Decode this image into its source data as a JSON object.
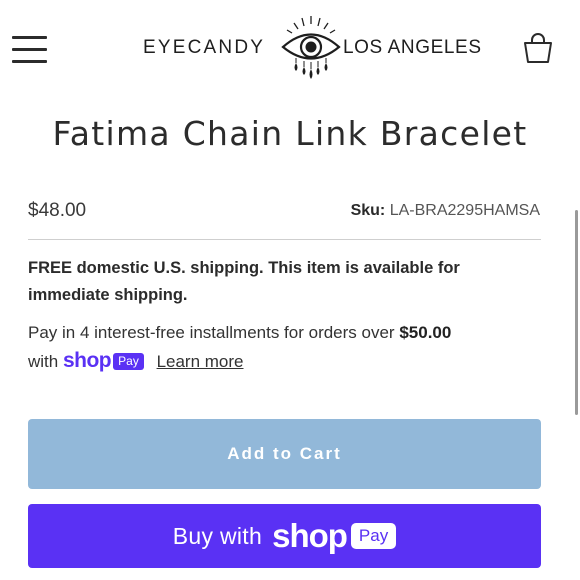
{
  "header": {
    "logo_left": "EYECANDY",
    "logo_right": "LOS ANGELES",
    "menu_icon": "hamburger-menu-icon",
    "cart_icon": "shopping-bag-icon"
  },
  "product": {
    "title": "Fatima Chain Link Bracelet",
    "price": "$48.00",
    "sku_label": "Sku:",
    "sku_value": "LA-BRA2295HAMSA"
  },
  "shipping_note": "FREE domestic U.S. shipping. This item is available for immediate shipping.",
  "installments": {
    "prefix": "Pay in 4 interest-free installments for orders over",
    "amount": "$50.00",
    "with": "with",
    "shop": "shop",
    "pay": "Pay",
    "learn_more": "Learn more"
  },
  "buttons": {
    "add_to_cart": "Add to Cart",
    "buy_with": "Buy with",
    "shop": "shop",
    "pay": "Pay"
  },
  "colors": {
    "shop_purple": "#5a31f4",
    "add_to_cart_bg": "#92b8d9",
    "text": "#2f2f2f"
  }
}
